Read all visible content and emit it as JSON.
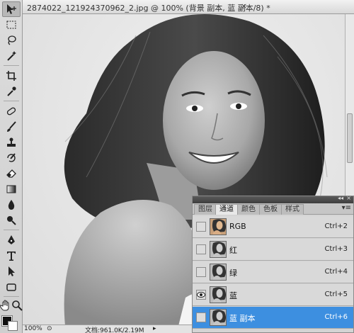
{
  "document": {
    "tab_title": "2874022_121924370962_2.jpg @ 100% (背景 副本, 蓝 副本/8) *",
    "close_glyph": "×",
    "zoom": "100%",
    "doc_info": "文档:961.0K/2.19M",
    "status_arrow": "▸"
  },
  "tools": [
    "move-tool",
    "marquee-tool",
    "lasso-tool",
    "magic-wand-tool",
    "crop-tool",
    "eyedropper-tool",
    "healing-tool",
    "brush-tool",
    "clone-stamp-tool",
    "history-brush-tool",
    "eraser-tool",
    "gradient-tool",
    "blur-tool",
    "dodge-tool",
    "pen-tool",
    "type-tool",
    "path-select-tool",
    "shape-tool",
    "hand-tool",
    "zoom-tool"
  ],
  "panel": {
    "collapse_glyph": "◂◂",
    "close_glyph": "×",
    "menu_glyph": "▾≡",
    "tabs": [
      "图层",
      "通道",
      "颜色",
      "色板",
      "样式"
    ],
    "active_tab": "通道",
    "channels": [
      {
        "name": "RGB",
        "shortcut": "Ctrl+2",
        "visible": false,
        "selected": false
      },
      {
        "name": "红",
        "shortcut": "Ctrl+3",
        "visible": false,
        "selected": false
      },
      {
        "name": "绿",
        "shortcut": "Ctrl+4",
        "visible": false,
        "selected": false
      },
      {
        "name": "蓝",
        "shortcut": "Ctrl+5",
        "visible": true,
        "selected": false
      },
      {
        "name": "蓝 副本",
        "shortcut": "Ctrl+6",
        "visible": false,
        "selected": true
      }
    ]
  },
  "colors": {
    "selection": "#3d8fe0",
    "foreground": "#111111",
    "background": "#ffffff"
  }
}
